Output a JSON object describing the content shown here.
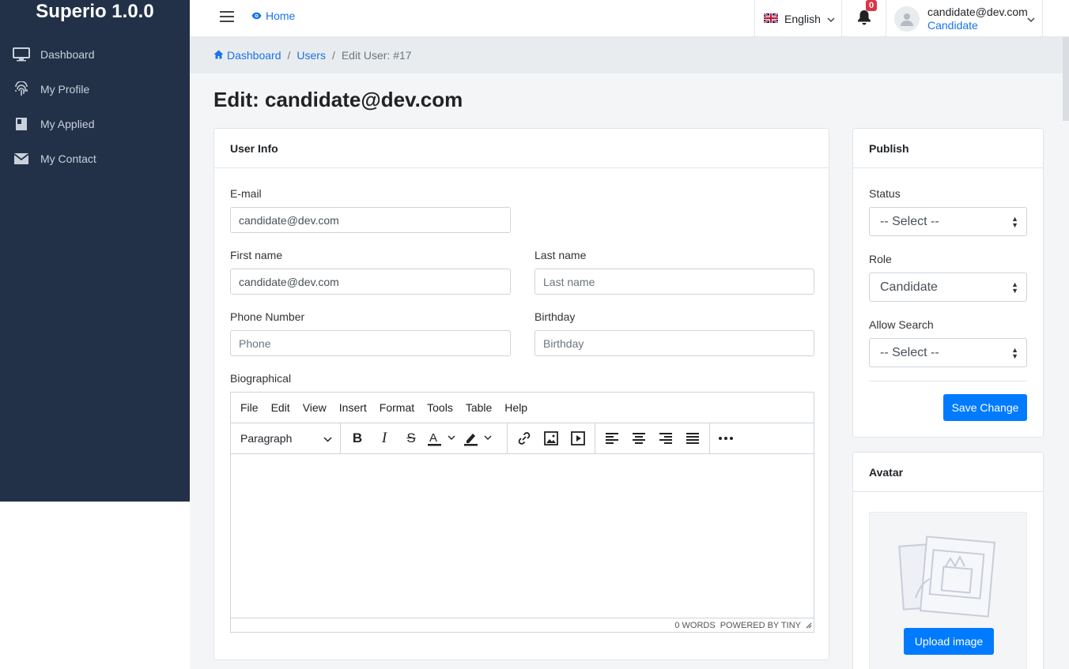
{
  "sidebar": {
    "brand": "Superio 1.0.0",
    "items": [
      {
        "label": "Dashboard",
        "icon": "monitor-icon"
      },
      {
        "label": "My Profile",
        "icon": "fingerprint-icon"
      },
      {
        "label": "My Applied",
        "icon": "book-icon"
      },
      {
        "label": "My Contact",
        "icon": "envelope-icon"
      }
    ]
  },
  "topbar": {
    "home_label": "Home",
    "language": "English",
    "notification_count": "0",
    "user_email": "candidate@dev.com",
    "user_role": "Candidate"
  },
  "breadcrumb": {
    "dashboard": "Dashboard",
    "users": "Users",
    "current": "Edit User: #17"
  },
  "page": {
    "title": "Edit: candidate@dev.com"
  },
  "user_info": {
    "heading": "User Info",
    "email_label": "E-mail",
    "email_value": "candidate@dev.com",
    "first_name_label": "First name",
    "first_name_value": "candidate@dev.com",
    "last_name_label": "Last name",
    "last_name_placeholder": "Last name",
    "phone_label": "Phone Number",
    "phone_placeholder": "Phone",
    "birthday_label": "Birthday",
    "birthday_placeholder": "Birthday",
    "bio_label": "Biographical",
    "editor_menu": [
      "File",
      "Edit",
      "View",
      "Insert",
      "Format",
      "Tools",
      "Table",
      "Help"
    ],
    "block_format": "Paragraph",
    "word_count": "0 WORDS",
    "powered_by": "POWERED BY TINY"
  },
  "publish": {
    "heading": "Publish",
    "status_label": "Status",
    "status_value": "-- Select --",
    "role_label": "Role",
    "role_value": "Candidate",
    "allow_search_label": "Allow Search",
    "allow_search_value": "-- Select --",
    "save_label": "Save Change"
  },
  "avatar": {
    "heading": "Avatar",
    "upload_label": "Upload image"
  },
  "colors": {
    "sidebar_bg": "#223148",
    "primary": "#007bff",
    "link": "#1a73e8",
    "badge": "#dc3545"
  }
}
